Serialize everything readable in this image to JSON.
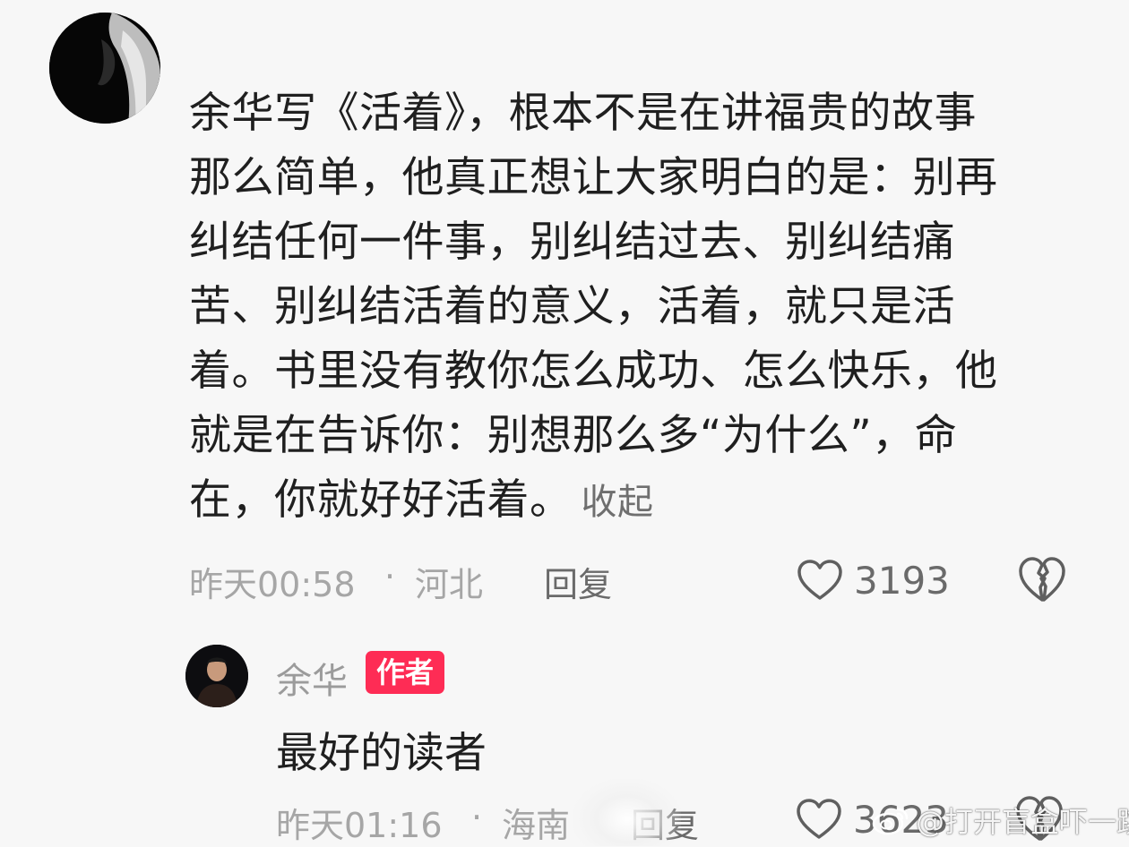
{
  "comment": {
    "lines": [
      "余华写《活着》，根本不是在讲福贵的故事",
      "那么简单，他真正想让大家明白的是：别再",
      "纠结任何一件事，别纠结过去、别纠结痛",
      "苦、别纠结活着的意义，活着，就只是活",
      "着。书里没有教你怎么成功、怎么快乐，他",
      "就是在告诉你：别想那么多“为什么”，命",
      "在，你就好好活着。"
    ],
    "collapse_label": "收起",
    "time": "昨天00:58",
    "separator": "·",
    "location": "河北",
    "reply_label": "回复",
    "like_count": "3193",
    "avatar_icon": "user-avatar-icon"
  },
  "author_reply": {
    "name": "余华",
    "badge": "作者",
    "text": "最好的读者",
    "time": "昨天01:16",
    "separator": "·",
    "location": "海南",
    "reply_label": "回复",
    "like_count": "3623"
  },
  "watermark": {
    "text": "@打开盲盒吓一跳"
  },
  "colors": {
    "background": "#f7f7f7",
    "text_primary": "#1f1f1f",
    "text_secondary": "#a6a6a6",
    "badge": "#fe2c55"
  }
}
